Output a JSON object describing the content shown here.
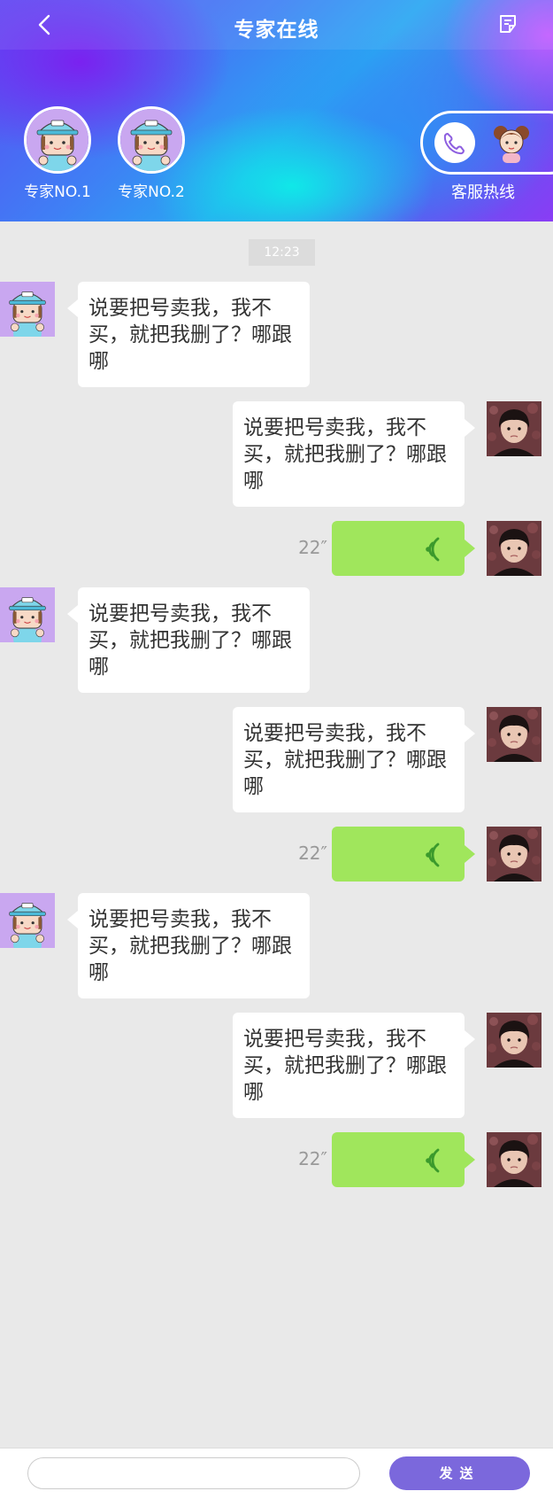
{
  "header": {
    "title": "专家在线",
    "back_icon": "chevron-left-icon",
    "right_icon": "notepad-icon"
  },
  "experts": [
    {
      "label": "专家NO.1"
    },
    {
      "label": "专家NO.2"
    }
  ],
  "hotline": {
    "label": "客服热线",
    "icon": "phone-icon"
  },
  "chat": {
    "timestamp": "12:23",
    "messages": [
      {
        "side": "left",
        "type": "text",
        "text": "说要把号卖我，我不买，就把我删了？哪跟哪"
      },
      {
        "side": "right",
        "type": "text",
        "text": "说要把号卖我，我不买，就把我删了？哪跟哪"
      },
      {
        "side": "right",
        "type": "voice",
        "duration": "22″"
      },
      {
        "side": "left",
        "type": "text",
        "text": "说要把号卖我，我不买，就把我删了？哪跟哪"
      },
      {
        "side": "right",
        "type": "text",
        "text": "说要把号卖我，我不买，就把我删了？哪跟哪"
      },
      {
        "side": "right",
        "type": "voice",
        "duration": "22″"
      },
      {
        "side": "left",
        "type": "text",
        "text": "说要把号卖我，我不买，就把我删了？哪跟哪"
      },
      {
        "side": "right",
        "type": "text",
        "text": "说要把号卖我，我不买，就把我删了？哪跟哪"
      },
      {
        "side": "right",
        "type": "voice",
        "duration": "22″"
      }
    ]
  },
  "composer": {
    "input_value": "",
    "send_label": "发送"
  },
  "colors": {
    "voice_bubble": "#a0e65c",
    "send_button": "#7b68dc",
    "background": "#e9e9e9"
  }
}
